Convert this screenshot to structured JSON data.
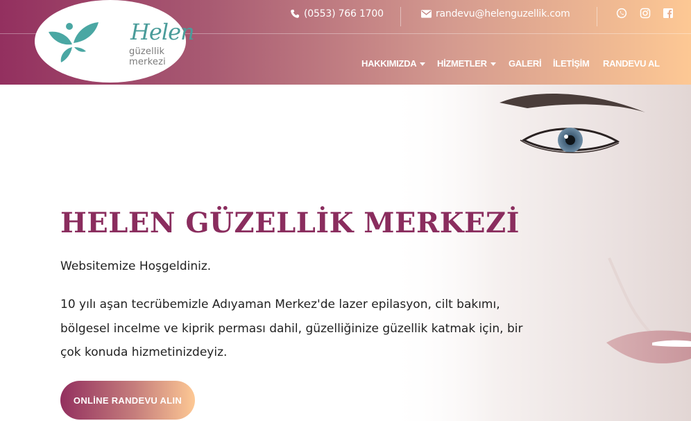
{
  "topbar": {
    "phone": "(0553) 766 1700",
    "email": "randevu@helenguzellik.com",
    "social_icons": [
      "whatsapp-icon",
      "instagram-icon",
      "facebook-icon"
    ]
  },
  "logo": {
    "script_text": "Helen",
    "subtitle": "güzellik merkezi"
  },
  "nav": {
    "items": [
      {
        "label": "HAKKIMIZDA",
        "dropdown": true
      },
      {
        "label": "HİZMETLER",
        "dropdown": true
      },
      {
        "label": "GALERİ",
        "dropdown": false
      },
      {
        "label": "İLETİŞİM",
        "dropdown": false
      },
      {
        "label": "RANDEVU AL",
        "dropdown": false
      }
    ]
  },
  "hero": {
    "title": "HELEN GÜZELLİK MERKEZİ",
    "welcome": "Websitemize Hoşgeldiniz.",
    "description": "10 yılı aşan tecrübemizle Adıyaman Merkez'de lazer epilasyon, cilt bakımı, bölgesel incelme ve kiprik perması dahil, güzelliğinize güzellik katmak için, bir çok konuda hizmetinizdeyiz.",
    "cta_label": "ONLİNE RANDEVU ALIN"
  },
  "colors": {
    "brand_plum": "#93305f",
    "brand_peach": "#fdc894",
    "logo_teal": "#4a9c9a",
    "title_color": "#8a2d5e"
  }
}
